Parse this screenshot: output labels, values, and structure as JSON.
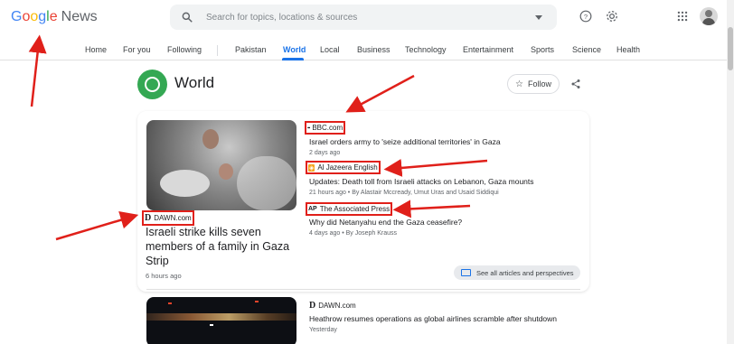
{
  "app": {
    "logo_letters": [
      "G",
      "o",
      "o",
      "g",
      "l",
      "e"
    ],
    "logo_suffix": "News"
  },
  "search": {
    "placeholder": "Search for topics, locations & sources"
  },
  "header_icons": [
    "help-icon",
    "settings-gear-icon",
    "apps-grid-icon"
  ],
  "nav": {
    "tabs": [
      "Home",
      "For you",
      "Following",
      "Pakistan",
      "World",
      "Local",
      "Business",
      "Technology",
      "Entertainment",
      "Sports",
      "Science",
      "Health"
    ],
    "active": "World"
  },
  "topic": {
    "title": "World",
    "follow_label": "Follow"
  },
  "story1": {
    "main": {
      "source": "DAWN.com",
      "source_logo": "D",
      "headline": "Israeli strike kills seven members of a family in Gaza Strip",
      "time": "6 hours ago"
    },
    "related": [
      {
        "source": "BBC.com",
        "source_logo": "▪▪▪",
        "headline": "Israel orders army to 'seize additional territories' in Gaza",
        "meta": "2 days ago"
      },
      {
        "source": "Al Jazeera English",
        "source_logo": "◈",
        "headline": "Updates: Death toll from Israeli attacks on Lebanon, Gaza mounts",
        "meta": "21 hours ago • By Alastair Mccready, Umut Uras and Usaid Siddiqui"
      },
      {
        "source": "The Associated Press",
        "source_logo": "AP",
        "headline": "Why did Netanyahu end the Gaza ceasefire?",
        "meta": "4 days ago • By Joseph Krauss"
      }
    ],
    "see_all": "See all articles and perspectives"
  },
  "story2": {
    "source": "DAWN.com",
    "source_logo": "D",
    "headline": "Heathrow resumes operations as global airlines scramble after shutdown",
    "meta": "Yesterday"
  },
  "colors": {
    "accent": "#1a73e8",
    "annotation_red": "#e0201a",
    "topic_green": "#34a853"
  }
}
